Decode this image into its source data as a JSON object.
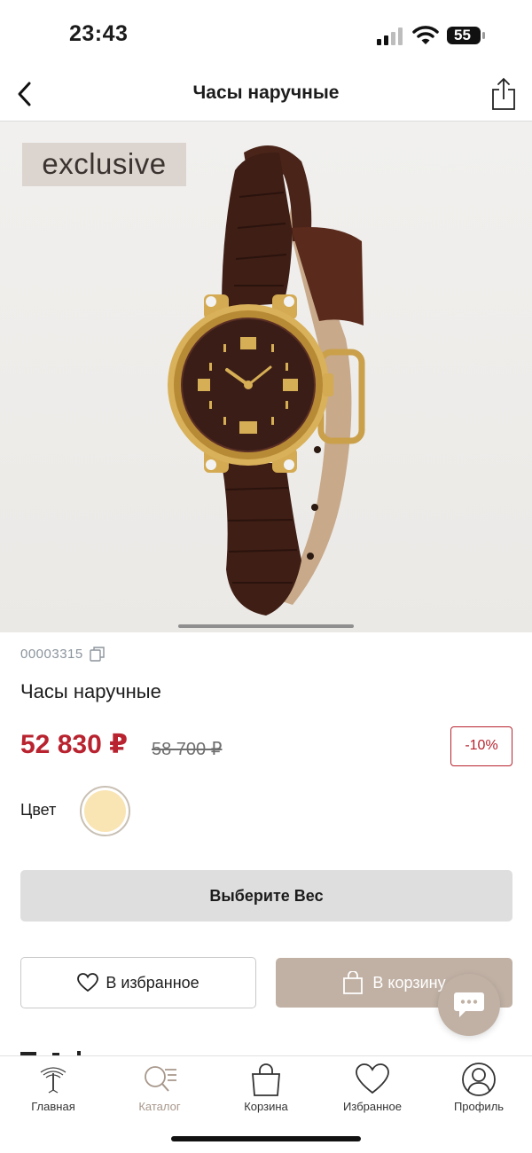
{
  "status_bar": {
    "time": "23:43",
    "battery_level": "55"
  },
  "nav": {
    "title": "Часы наручные",
    "back_icon": "chevron-left-icon",
    "share_icon": "share-icon"
  },
  "product": {
    "badge": "exclusive",
    "sku": "00003315",
    "name": "Часы наручные",
    "price": "52 830 ₽",
    "old_price": "58 700 ₽",
    "discount": "-10%",
    "color_label": "Цвет",
    "color_swatch": "#f9e4b4",
    "accent_color": "#b8232f",
    "brand_color": "#c1b1a5"
  },
  "actions": {
    "select_weight": "Выберите Вес",
    "favorite": "В избранное",
    "add_to_cart": "В корзину"
  },
  "tab_bar": {
    "items": [
      {
        "label": "Главная",
        "icon": "tree-logo-icon"
      },
      {
        "label": "Каталог",
        "icon": "catalog-search-icon",
        "active": true
      },
      {
        "label": "Корзина",
        "icon": "shopping-bag-icon"
      },
      {
        "label": "Избранное",
        "icon": "heart-icon"
      },
      {
        "label": "Профиль",
        "icon": "profile-icon"
      }
    ]
  }
}
